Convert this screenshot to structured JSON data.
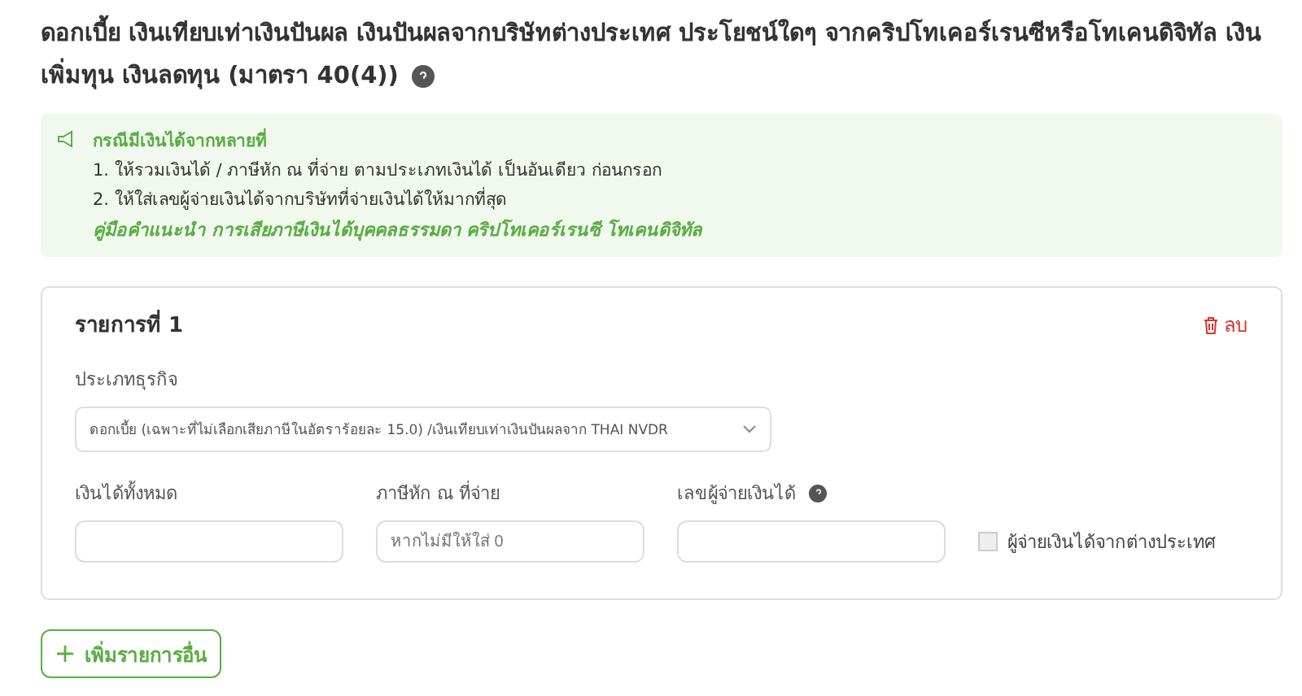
{
  "title": "ดอกเบี้ย เงินเทียบเท่าเงินปันผล เงินปันผลจากบริษัทต่างประเทศ ประโยชน์ใดๆ จากคริปโทเคอร์เรนซีหรือโทเคนดิจิทัล เงินเพิ่มทุน เงินลดทุน (มาตรา 40(4))",
  "notice": {
    "heading": "กรณีมีเงินได้จากหลายที่",
    "items": [
      "1. ให้รวมเงินได้ / ภาษีหัก ณ ที่จ่าย ตามประเภทเงินได้ เป็นอันเดียว ก่อนกรอก",
      "2. ให้ใส่เลขผู้จ่ายเงินได้จากบริษัทที่จ่ายเงินได้ให้มากที่สุด"
    ],
    "link": "คู่มือคำแนะนำ การเสียภาษีเงินได้บุคคลธรรมดา คริปโทเคอร์เรนซี โทเคนดิจิทัล"
  },
  "entry": {
    "title": "รายการที่ 1",
    "delete": "ลบ",
    "business_type": {
      "label": "ประเภทธุรกิจ",
      "value": "ดอกเบี้ย (เฉพาะที่ไม่เลือกเสียภาษีในอัตราร้อยละ 15.0) /เงินเทียบเท่าเงินปันผลจาก THAI NVDR"
    },
    "fields": [
      {
        "label": "เงินได้ทั้งหมด",
        "help": false
      },
      {
        "label": "ภาษีหัก ณ ที่จ่าย",
        "placeholder": "หากไม่มีให้ใส่ 0",
        "help": false
      },
      {
        "label": "เลขผู้จ่ายเงินได้",
        "help": true
      }
    ],
    "foreign": {
      "label": "ผู้จ่ายเงินได้จากต่างประเทศ",
      "checked": false
    }
  },
  "add_button": "เพิ่มรายการอื่น"
}
